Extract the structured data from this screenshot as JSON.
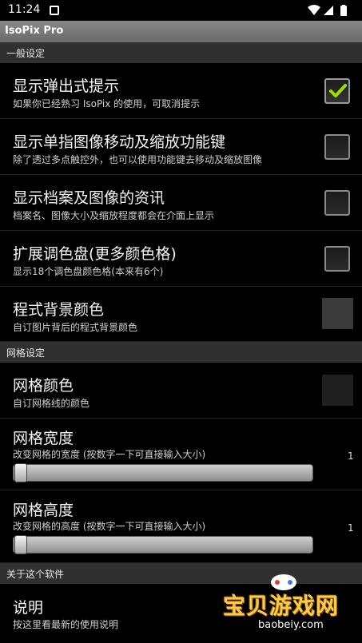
{
  "status_bar": {
    "time": "11:24"
  },
  "app_title": "IsoPix Pro",
  "sections": {
    "general": "一般设定",
    "grid": "网格设定",
    "about": "关于这个软件"
  },
  "prefs": {
    "popup_hints": {
      "title": "显示弹出式提示",
      "summary": "如果你已经熟习 IsoPix 的使用，可取消提示",
      "checked": true
    },
    "single_finger": {
      "title": "显示单指图像移动及缩放功能键",
      "summary": "除了透过多点触控外，也可以使用功能键去移动及缩放图像",
      "checked": false
    },
    "file_info": {
      "title": "显示档案及图像的资讯",
      "summary": "档案名、图像大小及缩放程度都会在介面上显示",
      "checked": false
    },
    "extended_palette": {
      "title": "扩展调色盘(更多颜色格)",
      "summary": "显示18个调色盘颜色格(本来有6个)",
      "checked": false
    },
    "background_color": {
      "title": "程式背景颜色",
      "summary": "自订图片背后的程式背景颜色",
      "swatch_color": "#3a3a3a"
    },
    "grid_color": {
      "title": "网格颜色",
      "summary": "自订网格线的颜色",
      "swatch_color": "#1f1f1f"
    },
    "grid_width": {
      "title": "网格宽度",
      "summary": "改变网格的宽度 (按数字一下可直接输入大小)",
      "value": "1"
    },
    "grid_height": {
      "title": "网格高度",
      "summary": "改变网格的高度 (按数字一下可直接输入大小)",
      "value": "1"
    },
    "instructions": {
      "title": "说明",
      "summary": "按这里看最新的使用说明"
    }
  },
  "watermark": {
    "text": "宝贝游戏网",
    "url": "baobeiy.com"
  },
  "colors": {
    "check_green": "#9be000",
    "section_bg": "#303030"
  }
}
